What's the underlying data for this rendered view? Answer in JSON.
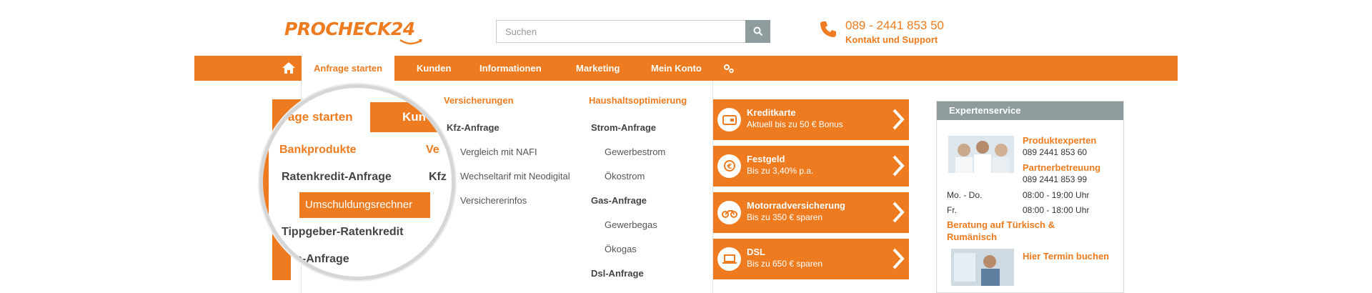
{
  "header": {
    "logo_text": "PROCHECK24",
    "search_placeholder": "Suchen",
    "phone": "089 - 2441 853 50",
    "contact_label": "Kontakt und Support"
  },
  "nav": {
    "items": [
      {
        "label": "Anfrage starten",
        "active": true
      },
      {
        "label": "Kunden"
      },
      {
        "label": "Informationen"
      },
      {
        "label": "Marketing"
      },
      {
        "label": "Mein Konto"
      }
    ]
  },
  "dropdown": {
    "versicherungen": {
      "heading": "Versicherungen",
      "sub": "Kfz-Anfrage",
      "links": [
        "Vergleich mit NAFI",
        "Wechseltarif mit Neodigital",
        "Versichererinfos"
      ]
    },
    "haushalt": {
      "heading": "Haushaltsoptimierung",
      "strom": "Strom-Anfrage",
      "strom_links": [
        "Gewerbestrom",
        "Ökostrom"
      ],
      "gas": "Gas-Anfrage",
      "gas_links": [
        "Gewerbegas",
        "Ökogas"
      ],
      "dsl": "Dsl-Anfrage"
    }
  },
  "left_partial": {
    "n_text": "n",
    "sparen_text": "sparen"
  },
  "magnifier": {
    "tab_active": "Anfrage starten",
    "tab_next": "Kun",
    "heading_bank": "Bankprodukte",
    "heading_ve": "Ve",
    "ratenkredit": "Ratenkredit-Anfrage",
    "kfz_partial": "Kfz",
    "highlight": "Umschuldungsrechner",
    "tippgeber": "Tippgeber-Ratenkredit",
    "giro": "Giro-Anfrage"
  },
  "tiles": [
    {
      "title": "Kreditkarte",
      "subtitle": "Aktuell bis zu 50 € Bonus",
      "icon": "credit-card-icon"
    },
    {
      "title": "Festgeld",
      "subtitle": "Bis zu 3,40% p.a.",
      "icon": "euro-coin-icon"
    },
    {
      "title": "Motorradversicherung",
      "subtitle": "Bis zu 350 € sparen",
      "icon": "motorcycle-icon"
    },
    {
      "title": "DSL",
      "subtitle": "Bis zu 650 € sparen",
      "icon": "laptop-icon"
    }
  ],
  "expert": {
    "title": "Expertenservice",
    "produktexperten": "Produktexperten",
    "produktexperten_phone": "089 2441 853 60",
    "partnerbetreuung": "Partnerbetreuung",
    "partnerbetreuung_phone": "089 2441 853 99",
    "hours": [
      {
        "day": "Mo. - Do.",
        "time": "08:00 - 19:00 Uhr"
      },
      {
        "day": "Fr.",
        "time": "08:00 - 18:00 Uhr"
      }
    ],
    "beratung_line1": "Beratung auf Türkisch &",
    "beratung_line2": "Rumänisch",
    "termin": "Hier Termin buchen"
  },
  "colors": {
    "brand_orange": "#ee7b1f",
    "gray_header": "#8f9c9d"
  }
}
